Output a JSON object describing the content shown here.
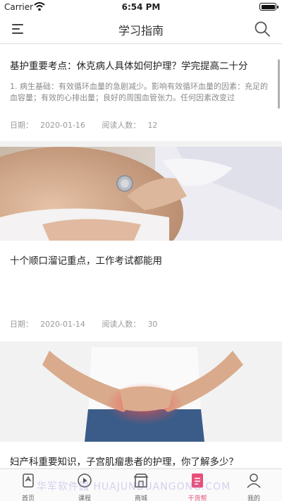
{
  "status": {
    "carrier": "Carrier",
    "time": "6:54 PM"
  },
  "nav": {
    "title": "学习指南"
  },
  "articles": [
    {
      "title": "基护重要考点：休克病人具体如何护理？学完提高二十分",
      "summary": "1. 病生基础：有效循环血量的急剧减少。影响有效循环血量的因素：充足的血容量；有效的心排出量；良好的周围血管张力。任何因素改变过",
      "date_label": "日期：",
      "date": "2020-01-16",
      "readers_label": "阅读人数：",
      "readers": "12"
    },
    {
      "title": "十个顺口溜记重点，工作考试都能用",
      "date_label": "日期：",
      "date": "2020-01-14",
      "readers_label": "阅读人数：",
      "readers": "30"
    },
    {
      "title": "妇产科重要知识，子宫肌瘤患者的护理，你了解多少？"
    }
  ],
  "tabs": [
    {
      "label": "首页"
    },
    {
      "label": "课程"
    },
    {
      "label": "商城"
    },
    {
      "label": "干货帮"
    },
    {
      "label": "我的"
    }
  ],
  "watermark": "华军软件园 HUAJUNDUANGONG.COM",
  "colors": {
    "accent": "#e8507a",
    "text": "#222222",
    "muted": "#9a9a9a",
    "background": "#f2f2f2"
  },
  "icons": [
    "wifi-icon",
    "battery-icon",
    "menu-icon",
    "search-icon",
    "home-icon",
    "course-icon",
    "shop-icon",
    "notes-icon",
    "profile-icon"
  ]
}
